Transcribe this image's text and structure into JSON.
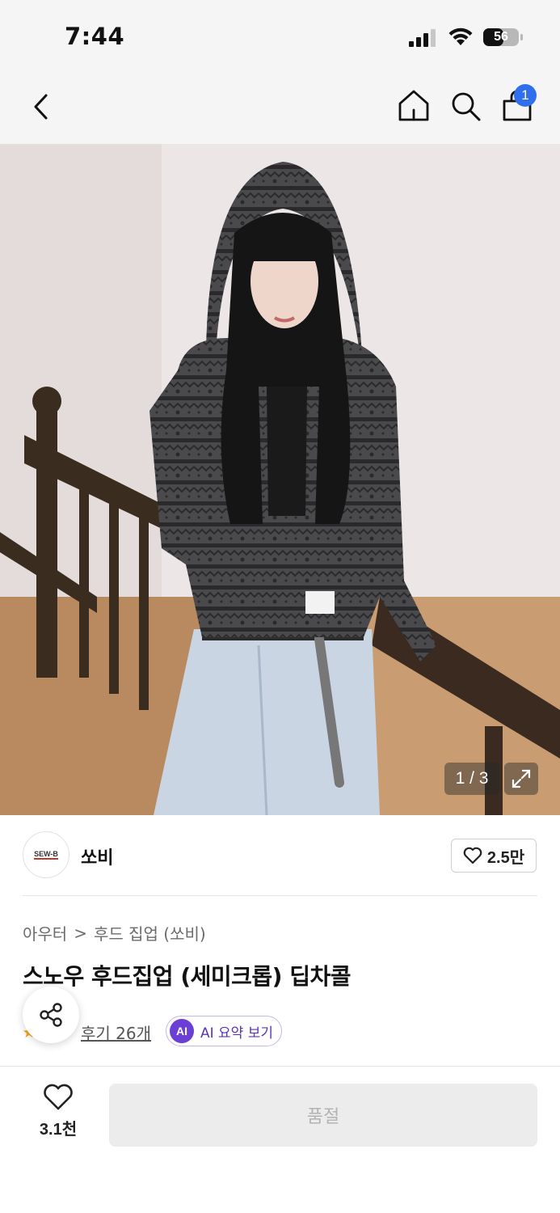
{
  "status_bar": {
    "time": "7:44",
    "battery": "56"
  },
  "nav": {
    "cart_count": "1"
  },
  "gallery": {
    "counter": "1 / 3"
  },
  "brand": {
    "name": "쏘비",
    "logo_text": "SEW-B",
    "likes": "2.5만"
  },
  "breadcrumb": {
    "level1": "아우터",
    "separator": ">",
    "level2": "후드 집업 (쏘비)"
  },
  "product": {
    "title": "스노우 후드집업 (세미크롭) 딥차콜"
  },
  "review": {
    "link_label": "후기 26개",
    "ai_badge": "AI",
    "ai_label": "AI 요약 보기"
  },
  "bottom_bar": {
    "wish_count": "3.1천",
    "soldout_label": "품절"
  },
  "colors": {
    "accent_blue": "#2f6fee",
    "ai_purple": "#6b3fd4",
    "soldout_bg": "#ececec"
  }
}
